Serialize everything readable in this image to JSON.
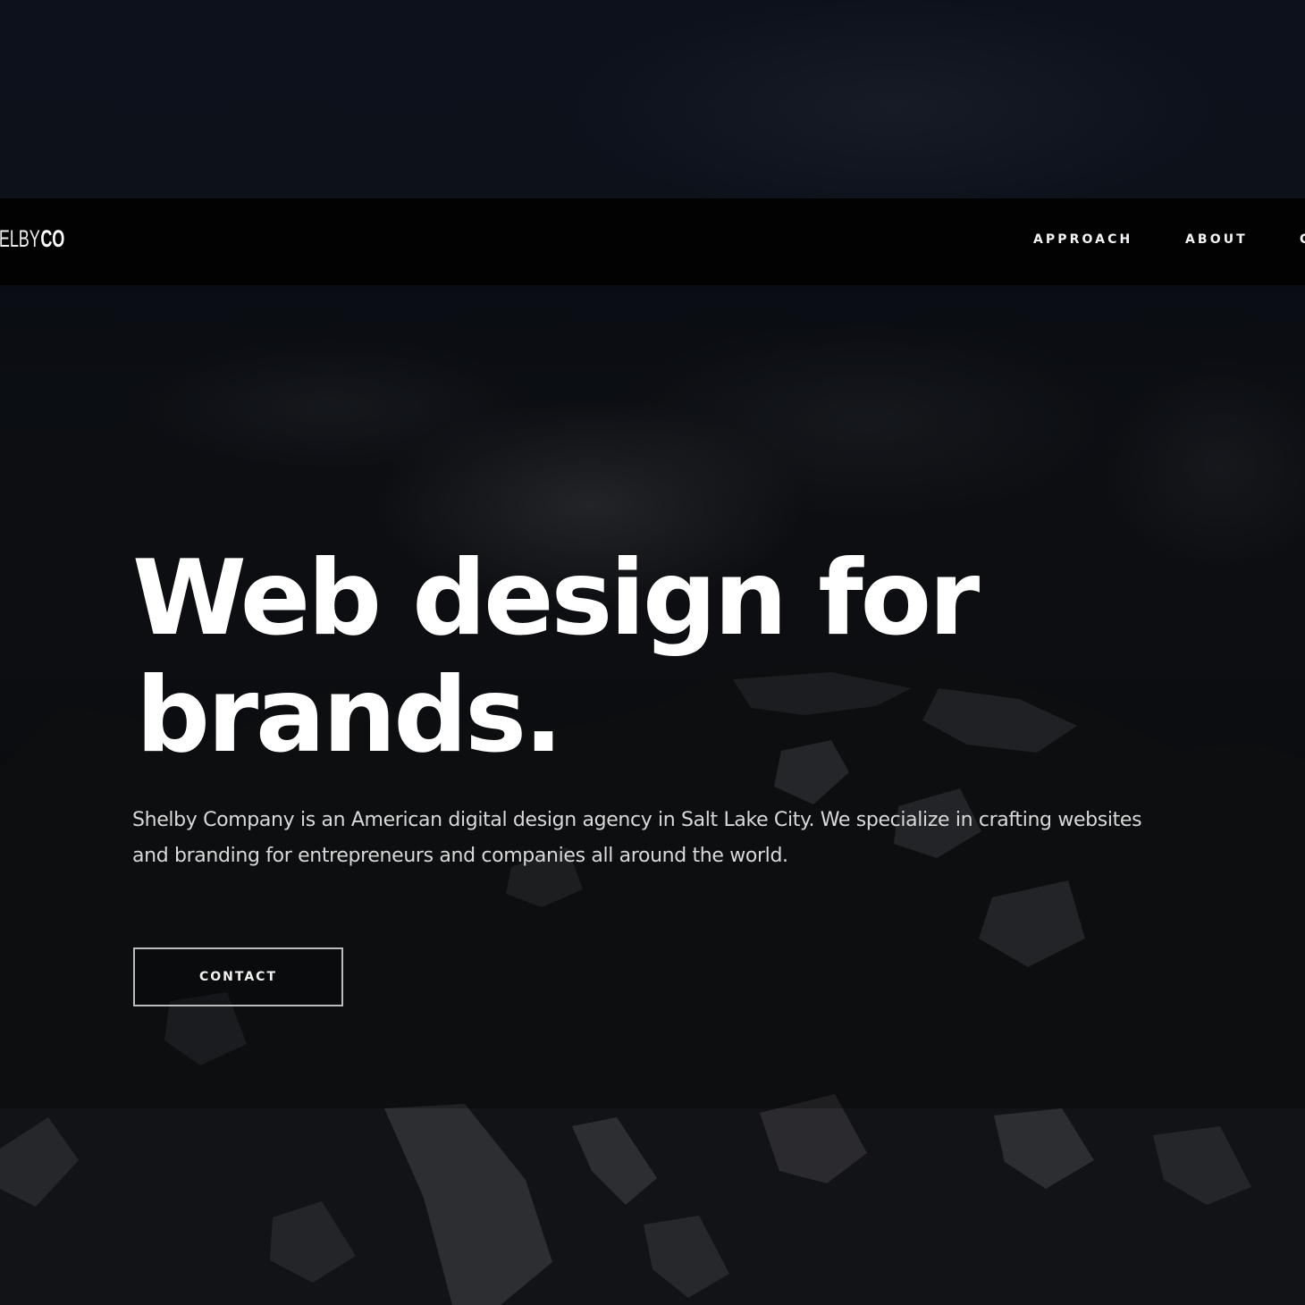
{
  "brand": {
    "logo_part1": "HELBY",
    "logo_part2": "CO"
  },
  "nav": {
    "items": [
      {
        "label": "APPROACH"
      },
      {
        "label": "ABOUT"
      }
    ],
    "partial_label": "C"
  },
  "hero": {
    "headline_line1": "Web design for",
    "headline_line2": "brands.",
    "subtext": "Shelby Company is an American digital design agency in Salt Lake City. We specialize in crafting websites and branding for entrepreneurs and companies all around the world.",
    "contact_label": "CONTACT"
  },
  "colors": {
    "background": "#0b0d12",
    "navbar": "#020203",
    "text": "#ffffff",
    "button_border": "#bcbcbc"
  }
}
